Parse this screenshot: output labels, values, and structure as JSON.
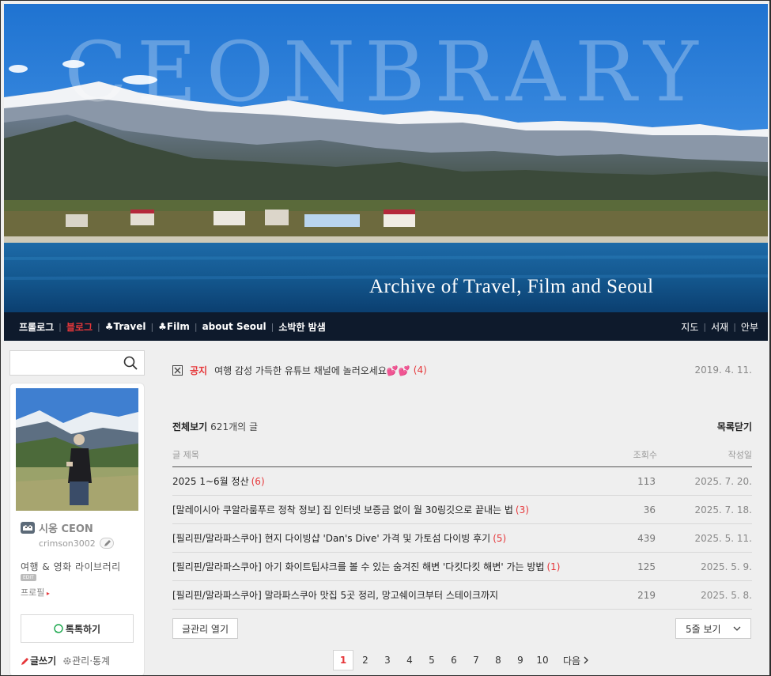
{
  "banner": {
    "title": "CEONBRARY",
    "subtitle": "Archive of Travel, Film and Seoul"
  },
  "nav": {
    "left": [
      {
        "label": "프롤로그",
        "active": false
      },
      {
        "label": "블로그",
        "active": true
      },
      {
        "label": "♣Travel",
        "active": false
      },
      {
        "label": "♣Film",
        "active": false
      },
      {
        "label": "about Seoul",
        "active": false
      },
      {
        "label": "소박한 밤샘",
        "active": false
      }
    ],
    "right": [
      "지도",
      "서재",
      "안부"
    ]
  },
  "search": {
    "placeholder": ""
  },
  "profile": {
    "name": "시옹 CEON",
    "id": "crimson3002",
    "description": "여행 & 영화 라이브러리",
    "edit_badge": "EDIT",
    "profile_link": "프로필",
    "talk_button": "톡톡하기",
    "write_link": "글쓰기",
    "manage_link": "관리·통계"
  },
  "notice": {
    "label": "공지",
    "text": "여행 감성 가득한 유튜브 채널에 놀러오세요💕💕",
    "count": "(4)",
    "date": "2019. 4. 11."
  },
  "list": {
    "title": "전체보기",
    "count_text": "621개의 글",
    "close_label": "목록닫기",
    "columns": {
      "title": "글 제목",
      "views": "조회수",
      "date": "작성일"
    },
    "rows": [
      {
        "title": "2025 1~6월 정산",
        "comments": "(6)",
        "views": "113",
        "date": "2025. 7. 20."
      },
      {
        "title": "[말레이시아 쿠알라룸푸르 정착 정보] 집 인터넷 보증금 없이 월 30링깃으로 끝내는 법",
        "comments": "(3)",
        "views": "36",
        "date": "2025. 7. 18."
      },
      {
        "title": "[필리핀/말라파스쿠아] 현지 다이빙샵 'Dan's Dive' 가격 및 가토섬 다이빙 후기",
        "comments": "(5)",
        "views": "439",
        "date": "2025. 5. 11."
      },
      {
        "title": "[필리핀/말라파스쿠아] 아기 화이트팁샤크를 볼 수 있는 숨겨진 해변 '다킷다킷 해변' 가는 방법",
        "comments": "(1)",
        "views": "125",
        "date": "2025. 5. 9."
      },
      {
        "title": "[필리핀/말라파스쿠아] 말라파스쿠아 맛집 5곳 정리, 망고쉐이크부터 스테이크까지",
        "comments": "",
        "views": "219",
        "date": "2025. 5. 8."
      }
    ],
    "manage_button": "글관리 열기",
    "view_select": "5줄 보기"
  },
  "pager": {
    "pages": [
      "1",
      "2",
      "3",
      "4",
      "5",
      "6",
      "7",
      "8",
      "9",
      "10"
    ],
    "current": "1",
    "next_label": "다음"
  },
  "colors": {
    "accent": "#e6373a",
    "nav_bg": "#0e1a2c",
    "page_bg": "#efefef"
  }
}
